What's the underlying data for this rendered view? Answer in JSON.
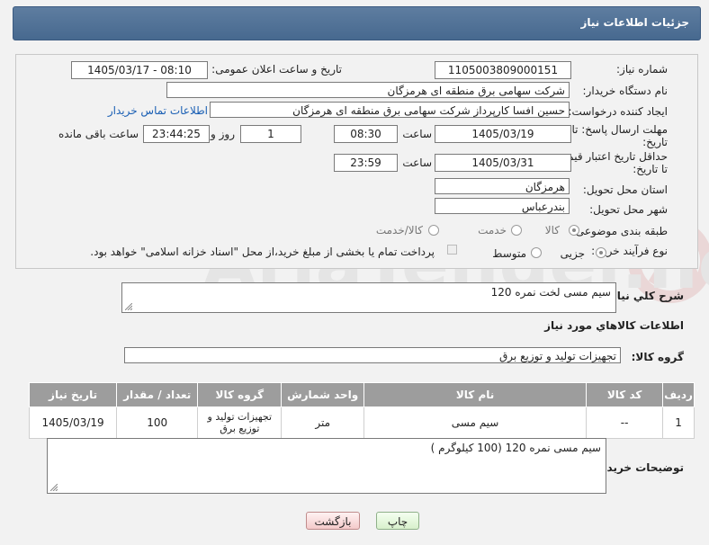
{
  "header": {
    "title": "جزئیات اطلاعات نیاز"
  },
  "form": {
    "need_number_label": "شماره نیاز:",
    "need_number": "1105003809000151",
    "announce_label": "تاریخ و ساعت اعلان عمومی:",
    "announce_value": "1405/03/17 - 08:10",
    "buyer_org_label": "نام دستگاه خریدار:",
    "buyer_org": "شرکت سهامی برق منطقه ای هرمزگان",
    "requester_label": "ایجاد کننده درخواست:",
    "requester": "حسین افسا کارپرداز شرکت سهامی برق منطقه ای هرمزگان",
    "contact_link": "اطلاعات تماس خریدار",
    "deadline_label_1": "مهلت ارسال پاسخ: تا",
    "deadline_label_2": "تاریخ:",
    "deadline_date": "1405/03/19",
    "time_label": "ساعت",
    "deadline_time": "08:30",
    "days_value": "1",
    "days_label": "روز و",
    "remaining_time": "23:44:25",
    "remaining_label": "ساعت باقی مانده",
    "validity_label_1": "حداقل تاریخ اعتبار قیمت:",
    "validity_label_2": "تا تاریخ:",
    "validity_date": "1405/03/31",
    "validity_time": "23:59",
    "province_label": "استان محل تحویل:",
    "province": "هرمزگان",
    "city_label": "شهر محل تحویل:",
    "city": "بندرعباس",
    "category_label": "طبقه بندی موضوعی:",
    "category_options": [
      "کالا",
      "خدمت",
      "کالا/خدمت"
    ],
    "process_label": "نوع فرآیند خرید :",
    "process_options": [
      "جزیی",
      "متوسط"
    ],
    "payment_note": "پرداخت تمام یا بخشی از مبلغ خرید،از محل \"اسناد خزانه اسلامی\" خواهد بود."
  },
  "summary": {
    "label": "شرح کلي نياز:",
    "value": "سیم مسی لخت نمره 120"
  },
  "goods_section": {
    "title": "اطلاعات کالاهاي مورد نياز",
    "group_label": "گروه کالا:",
    "group_value": "تجهیزات تولید و توزیع برق"
  },
  "table": {
    "headers": [
      "ردیف",
      "کد کالا",
      "نام کالا",
      "واحد شمارش",
      "گروه کالا",
      "تعداد / مقدار",
      "تاریخ نیاز"
    ],
    "rows": [
      [
        "1",
        "--",
        "سیم مسی",
        "متر",
        "تجهیزات تولید و توزیع برق",
        "100",
        "1405/03/19"
      ]
    ]
  },
  "buyer_notes": {
    "label": "توضیحات خریدار:",
    "value": "سیم مسی نمره 120  (100 کیلوگرم )"
  },
  "buttons": {
    "print": "چاپ",
    "back": "بازگشت"
  },
  "watermark": {
    "text": "AriaTender.neT"
  }
}
